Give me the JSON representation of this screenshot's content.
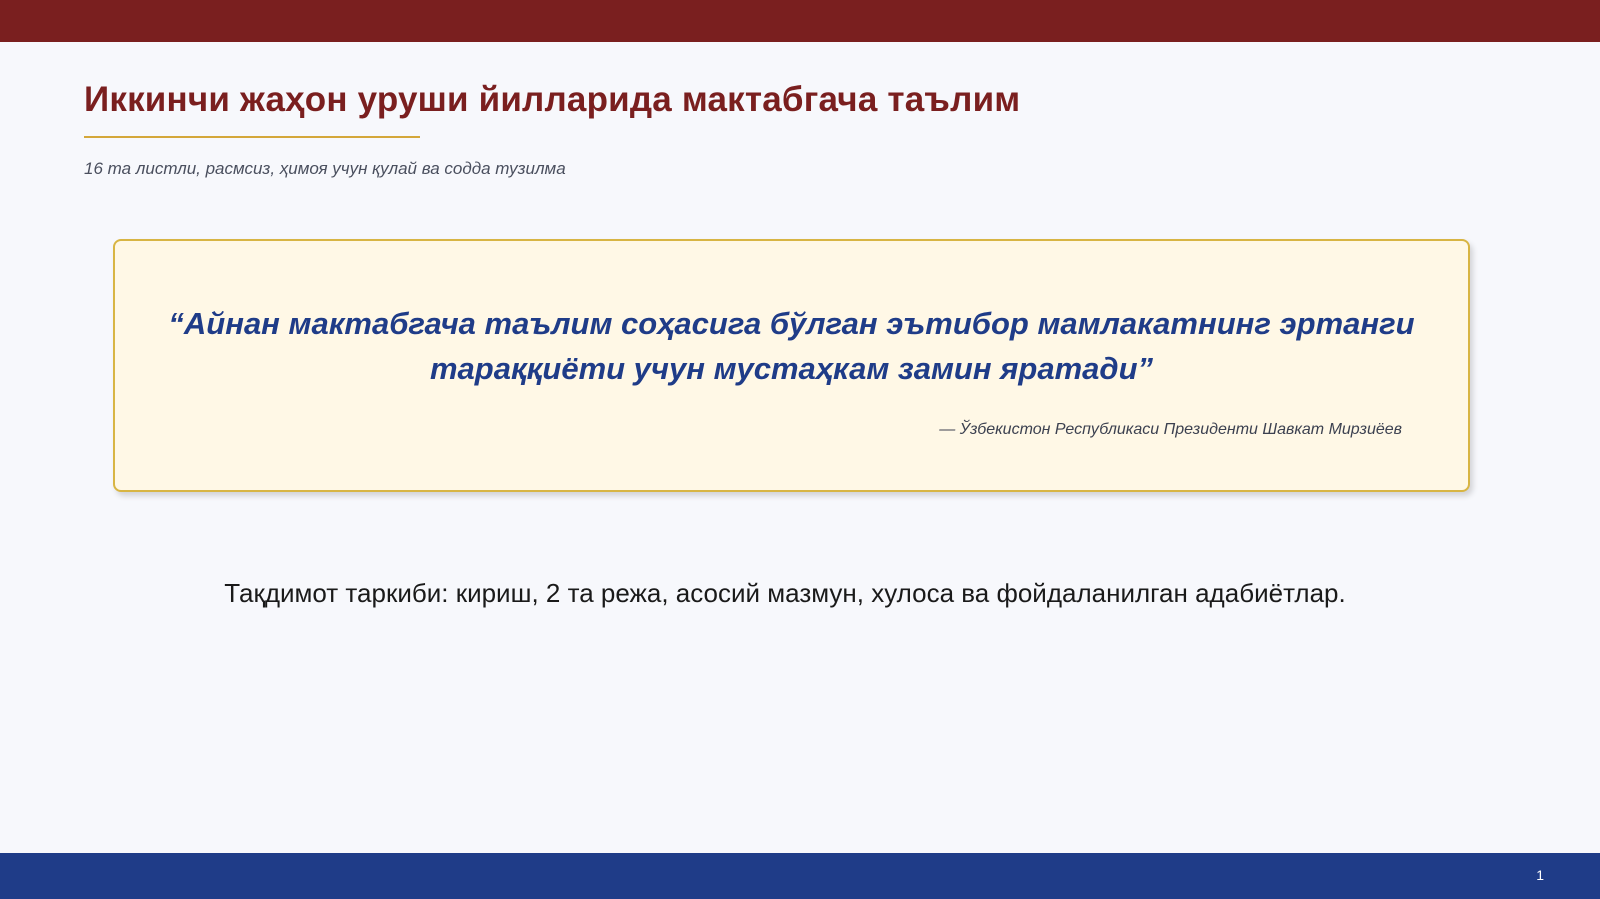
{
  "slide": {
    "title": "Иккинчи жаҳон уруши йилларида мактабгача таълим",
    "subtitle": "16 та листли, расмсиз, ҳимоя учун қулай ва содда тузилма",
    "quote": {
      "text": "“Айнан мактабгача таълим соҳасига бўлган эътибор мамлакатнинг эртанги тараққиёти учун мустаҳкам замин яратади”",
      "author": "— Ўзбекистон Республикаси Президенти Шавкат Мирзиёев"
    },
    "structure": "Тақдимот таркиби: кириш, 2 та режа, асосий мазмун, хулоса ва фойдаланилган адабиётлар.",
    "page_number": "1"
  },
  "colors": {
    "top_bar": "#7a1f1f",
    "bottom_bar": "#1f3c88",
    "accent_gold": "#d4a73a",
    "quote_text": "#1f3c88",
    "quote_background": "#fff8e6"
  }
}
